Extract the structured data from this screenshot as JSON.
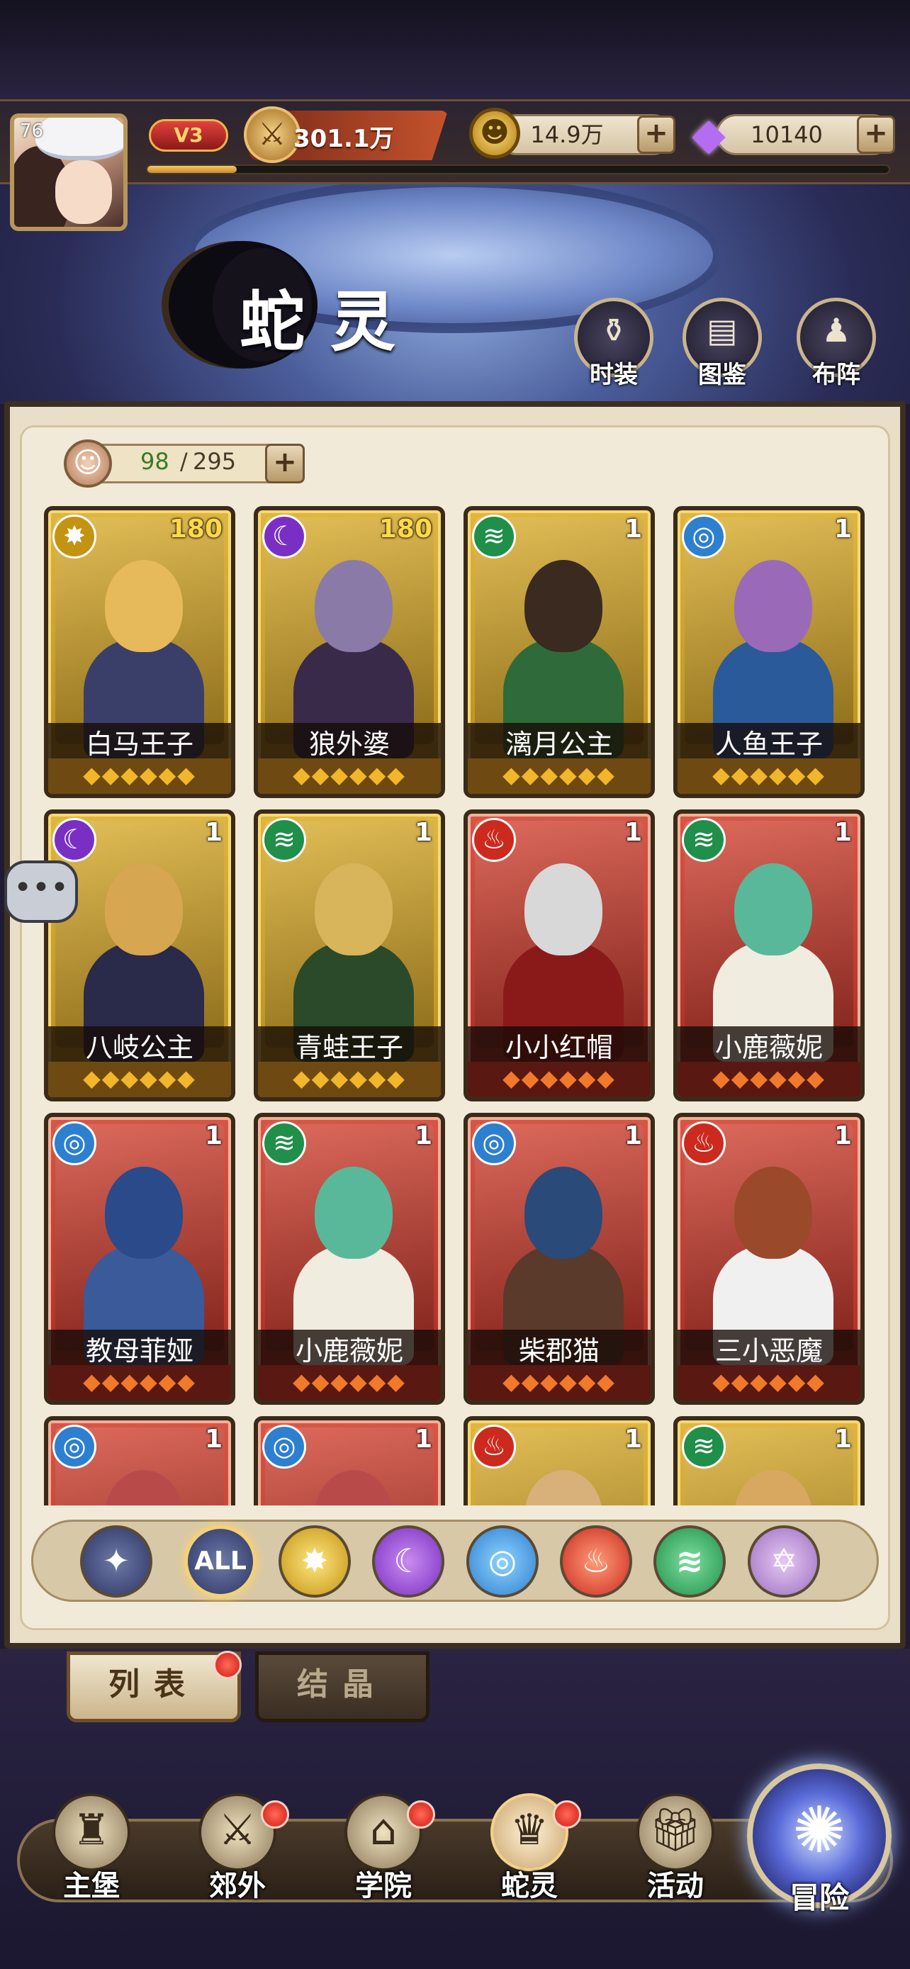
{
  "header": {
    "level": "76",
    "vip": "V3",
    "power": "301.1万",
    "power_icon": "sword-shield-icon",
    "exp_progress_fraction": 0.12,
    "gold": "14.9万",
    "gems": "10140",
    "plus": "+"
  },
  "page": {
    "title": "蛇灵",
    "buttons": [
      {
        "label": "时装",
        "icon": "vase-icon"
      },
      {
        "label": "图鉴",
        "icon": "book-icon"
      },
      {
        "label": "布阵",
        "icon": "formation-icon"
      }
    ]
  },
  "capacity": {
    "current": "98",
    "separator": "/",
    "max": "295",
    "plus": "+"
  },
  "elements": {
    "light": {
      "glyph": "✸",
      "color": "#c49312"
    },
    "dark": {
      "glyph": "☾",
      "color": "#7a2fc4"
    },
    "wind": {
      "glyph": "≋",
      "color": "#1f8f4a"
    },
    "water": {
      "glyph": "◎",
      "color": "#2d7fd0"
    },
    "fire": {
      "glyph": "♨",
      "color": "#cc2a1e"
    },
    "holy": {
      "glyph": "✡",
      "color": "#9a70c0"
    }
  },
  "cards": [
    {
      "name": "白马王子",
      "stars": "180",
      "element": "light",
      "rarity": "gold",
      "hair": "#e6b95a",
      "outfit": "#3a3f6a"
    },
    {
      "name": "狼外婆",
      "stars": "180",
      "element": "dark",
      "rarity": "gold",
      "hair": "#8a7aa8",
      "outfit": "#3a2a4a"
    },
    {
      "name": "漓月公主",
      "stars": "1",
      "element": "wind",
      "rarity": "gold",
      "hair": "#3a2a20",
      "outfit": "#2f6a3a"
    },
    {
      "name": "人鱼王子",
      "stars": "1",
      "element": "water",
      "rarity": "gold",
      "hair": "#9a6ab8",
      "outfit": "#2a5a9a"
    },
    {
      "name": "八岐公主",
      "stars": "1",
      "element": "dark",
      "rarity": "gold",
      "hair": "#d6a650",
      "outfit": "#2a2a4a"
    },
    {
      "name": "青蛙王子",
      "stars": "1",
      "element": "wind",
      "rarity": "gold",
      "hair": "#d8b45a",
      "outfit": "#2a4a2a"
    },
    {
      "name": "小小红帽",
      "stars": "1",
      "element": "fire",
      "rarity": "red",
      "hair": "#d8d8d8",
      "outfit": "#8a1a1a"
    },
    {
      "name": "小鹿薇妮",
      "stars": "1",
      "element": "wind",
      "rarity": "red",
      "hair": "#5ab89a",
      "outfit": "#f0ece0"
    },
    {
      "name": "教母菲娅",
      "stars": "1",
      "element": "water",
      "rarity": "red",
      "hair": "#2a4a8a",
      "outfit": "#3a5a9a"
    },
    {
      "name": "小鹿薇妮",
      "stars": "1",
      "element": "wind",
      "rarity": "red",
      "hair": "#5ab89a",
      "outfit": "#f0ece0"
    },
    {
      "name": "柴郡猫",
      "stars": "1",
      "element": "water",
      "rarity": "red",
      "hair": "#2a4a7a",
      "outfit": "#5a3a2a"
    },
    {
      "name": "三小恶魔",
      "stars": "1",
      "element": "fire",
      "rarity": "red",
      "hair": "#9a4a2a",
      "outfit": "#f0f0f0"
    },
    {
      "name": "",
      "stars": "1",
      "element": "water",
      "rarity": "red",
      "hair": "#b84a4a",
      "outfit": "#2a2a5a"
    },
    {
      "name": "",
      "stars": "1",
      "element": "water",
      "rarity": "red",
      "hair": "#b84a4a",
      "outfit": "#2a2a5a"
    },
    {
      "name": "",
      "stars": "1",
      "element": "fire",
      "rarity": "gold",
      "hair": "#d8b07a",
      "outfit": "#f0e0d0"
    },
    {
      "name": "",
      "stars": "1",
      "element": "wind",
      "rarity": "gold",
      "hair": "#d8a860",
      "outfit": "#e0d0b0"
    }
  ],
  "chat_icon": "chat-bubble-icon",
  "filters": [
    {
      "id": "fav",
      "label": "",
      "icon": "star-wing-icon"
    },
    {
      "id": "all",
      "label": "ALL",
      "icon": ""
    },
    {
      "id": "light",
      "label": "",
      "icon": "light-element-icon"
    },
    {
      "id": "dark",
      "label": "",
      "icon": "dark-element-icon"
    },
    {
      "id": "water",
      "label": "",
      "icon": "water-element-icon"
    },
    {
      "id": "fire",
      "label": "",
      "icon": "fire-element-icon"
    },
    {
      "id": "wind",
      "label": "",
      "icon": "wind-element-icon"
    },
    {
      "id": "holy",
      "label": "",
      "icon": "holy-element-icon"
    }
  ],
  "tabs": [
    {
      "label": "列表",
      "active": true,
      "badge": true
    },
    {
      "label": "结晶",
      "active": false,
      "badge": false
    }
  ],
  "nav": [
    {
      "label": "主堡",
      "icon": "castle-icon",
      "badge": false
    },
    {
      "label": "郊外",
      "icon": "crossed-swords-icon",
      "badge": true
    },
    {
      "label": "学院",
      "icon": "academy-icon",
      "badge": true
    },
    {
      "label": "蛇灵",
      "icon": "spirit-icon",
      "badge": true
    },
    {
      "label": "活动",
      "icon": "gift-box-icon",
      "badge": false
    },
    {
      "label": "冒险",
      "icon": "adventure-portal-icon",
      "badge": false
    }
  ]
}
